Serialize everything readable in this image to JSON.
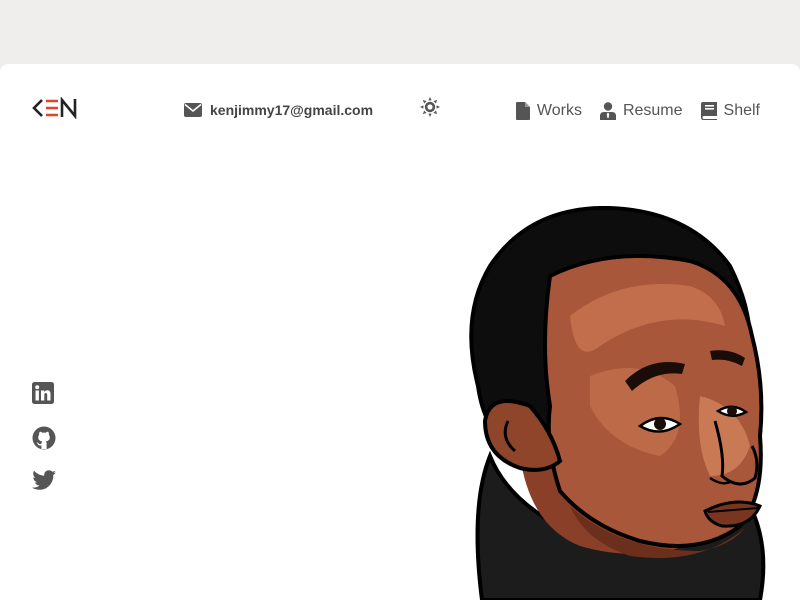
{
  "logo": {
    "icon": "ken-logo-icon",
    "accent": "#e0442a",
    "ink": "#222222"
  },
  "header": {
    "email": "kenjimmy17@gmail.com",
    "email_icon": "envelope-icon",
    "theme_icon": "sun-icon"
  },
  "nav": {
    "items": [
      {
        "label": "Works",
        "icon": "file-icon"
      },
      {
        "label": "Resume",
        "icon": "user-tie-icon"
      },
      {
        "label": "Shelf",
        "icon": "book-icon"
      }
    ]
  },
  "social": {
    "items": [
      {
        "icon": "linkedin-icon"
      },
      {
        "icon": "github-icon"
      },
      {
        "icon": "twitter-icon"
      }
    ]
  },
  "colors": {
    "background": "#efeeec",
    "card": "#ffffff",
    "text": "#555555",
    "skin": "#a9573a",
    "hair": "#111111"
  }
}
